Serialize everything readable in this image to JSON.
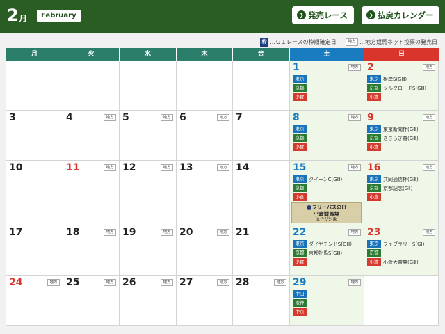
{
  "header": {
    "month_number": "2",
    "month_unit": "月",
    "month_english": "February",
    "sale_race_button": "発売レース",
    "payout_calendar_button": "払戻カレンダー"
  },
  "legend": {
    "waku_icon": "枠",
    "waku_text": "…ＧＩレースの枠順確定日",
    "chiho_icon": "地方",
    "chiho_text": "…地方競馬ネット投票の発売日"
  },
  "weekdays": [
    "月",
    "火",
    "水",
    "木",
    "金",
    "土",
    "日"
  ],
  "colors": {
    "header_green": "#2a5d23",
    "weekday_teal": "#2b7e6a",
    "saturday_blue": "#1a7cc0",
    "sunday_red": "#d9352c",
    "weekend_bg": "#eef7e8"
  },
  "chiho_label": "地方",
  "weeks": [
    [
      {
        "day": ""
      },
      {
        "day": ""
      },
      {
        "day": ""
      },
      {
        "day": ""
      },
      {
        "day": ""
      },
      {
        "day": "1",
        "color": "blue",
        "chiho": true,
        "venues": [
          {
            "name": "東京",
            "color": "blue",
            "race": ""
          },
          {
            "name": "京都",
            "color": "green",
            "race": ""
          },
          {
            "name": "小倉",
            "color": "red",
            "race": ""
          }
        ]
      },
      {
        "day": "2",
        "color": "red",
        "chiho": true,
        "venues": [
          {
            "name": "東京",
            "color": "blue",
            "race": "根岸S(GⅢ)"
          },
          {
            "name": "京都",
            "color": "green",
            "race": "シルクロードS(GⅢ)"
          },
          {
            "name": "小倉",
            "color": "red",
            "race": ""
          }
        ]
      }
    ],
    [
      {
        "day": "3"
      },
      {
        "day": "4",
        "chiho": true
      },
      {
        "day": "5",
        "chiho": true
      },
      {
        "day": "6",
        "chiho": true
      },
      {
        "day": "7"
      },
      {
        "day": "8",
        "color": "blue",
        "chiho": true,
        "venues": [
          {
            "name": "東京",
            "color": "blue",
            "race": ""
          },
          {
            "name": "京都",
            "color": "green",
            "race": ""
          },
          {
            "name": "小倉",
            "color": "red",
            "race": ""
          }
        ]
      },
      {
        "day": "9",
        "color": "red",
        "chiho": true,
        "venues": [
          {
            "name": "東京",
            "color": "blue",
            "race": "東京新聞杯(GⅢ)"
          },
          {
            "name": "京都",
            "color": "green",
            "race": "きさらぎ賞(GⅢ)"
          },
          {
            "name": "小倉",
            "color": "red",
            "race": ""
          }
        ]
      }
    ],
    [
      {
        "day": "10"
      },
      {
        "day": "11",
        "color": "red",
        "chiho": true
      },
      {
        "day": "12",
        "chiho": true
      },
      {
        "day": "13",
        "chiho": true
      },
      {
        "day": "14"
      },
      {
        "day": "15",
        "color": "blue",
        "chiho": true,
        "venues": [
          {
            "name": "東京",
            "color": "blue",
            "race": "クイーンC(GⅢ)"
          },
          {
            "name": "京都",
            "color": "green",
            "race": ""
          },
          {
            "name": "小倉",
            "color": "red",
            "race": ""
          }
        ],
        "freepass": {
          "title": "フリーパスの日",
          "venue": "小倉競馬場",
          "note": "女性が対象"
        }
      },
      {
        "day": "16",
        "color": "red",
        "chiho": true,
        "venues": [
          {
            "name": "東京",
            "color": "blue",
            "race": "共同通信杯(GⅢ)"
          },
          {
            "name": "京都",
            "color": "green",
            "race": "京都記念(GⅡ)"
          },
          {
            "name": "小倉",
            "color": "red",
            "race": ""
          }
        ]
      }
    ],
    [
      {
        "day": "17"
      },
      {
        "day": "18",
        "chiho": true
      },
      {
        "day": "19",
        "chiho": true
      },
      {
        "day": "20",
        "chiho": true
      },
      {
        "day": "21"
      },
      {
        "day": "22",
        "color": "blue",
        "chiho": true,
        "venues": [
          {
            "name": "東京",
            "color": "blue",
            "race": "ダイヤモンドS(GⅢ)"
          },
          {
            "name": "京都",
            "color": "green",
            "race": "京都牝馬S(GⅢ)"
          },
          {
            "name": "小倉",
            "color": "red",
            "race": ""
          }
        ]
      },
      {
        "day": "23",
        "color": "red",
        "chiho": true,
        "venues": [
          {
            "name": "東京",
            "color": "blue",
            "race": "フェブラリーS(GⅠ)"
          },
          {
            "name": "京都",
            "color": "green",
            "race": ""
          },
          {
            "name": "小倉",
            "color": "red",
            "race": "小倉大賞典(GⅢ)"
          }
        ]
      }
    ],
    [
      {
        "day": "24",
        "color": "red",
        "chiho": true
      },
      {
        "day": "25",
        "chiho": true
      },
      {
        "day": "26",
        "chiho": true
      },
      {
        "day": "27",
        "chiho": true
      },
      {
        "day": "28",
        "chiho": true
      },
      {
        "day": "29",
        "color": "blue",
        "chiho": true,
        "venues": [
          {
            "name": "中山",
            "color": "blue",
            "race": ""
          },
          {
            "name": "阪神",
            "color": "green",
            "race": ""
          },
          {
            "name": "中京",
            "color": "red",
            "race": ""
          }
        ]
      },
      {
        "day": ""
      }
    ]
  ]
}
